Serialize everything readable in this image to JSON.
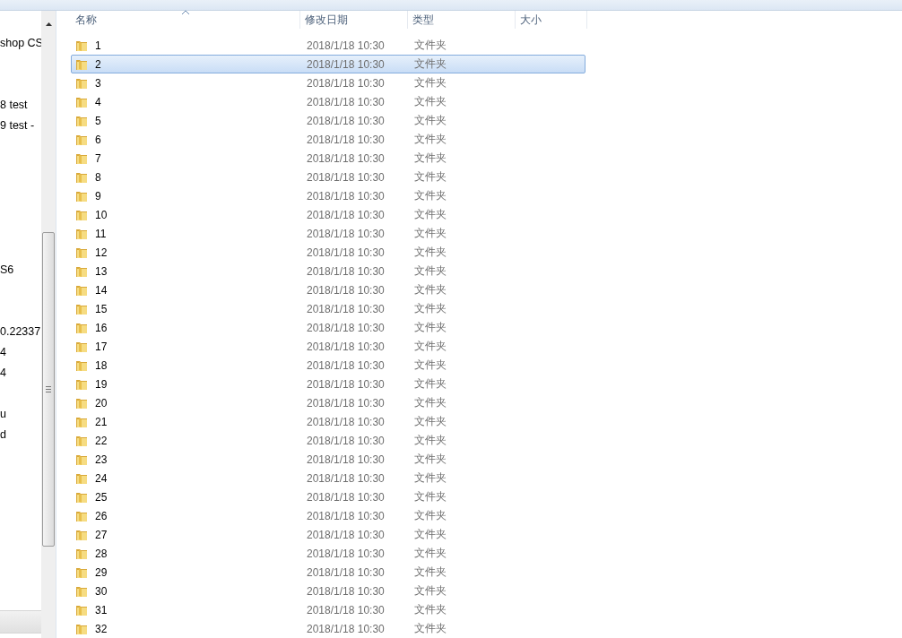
{
  "sidebar": {
    "items": [
      {
        "label": "shop CS"
      },
      {
        "label": "8 test"
      },
      {
        "label": "9 test -"
      },
      {
        "label": "S6"
      },
      {
        "label": "0.22337"
      },
      {
        "label": "4"
      },
      {
        "label": "4"
      },
      {
        "label": "u"
      },
      {
        "label": "d"
      }
    ]
  },
  "table": {
    "columns": [
      {
        "label": "名称",
        "sorted": true
      },
      {
        "label": "修改日期",
        "sorted": false
      },
      {
        "label": "类型",
        "sorted": false
      },
      {
        "label": "大小",
        "sorted": false
      }
    ],
    "rows": [
      {
        "name": "1",
        "modified": "2018/1/18 10:30",
        "type": "文件夹",
        "selected": false
      },
      {
        "name": "2",
        "modified": "2018/1/18 10:30",
        "type": "文件夹",
        "selected": true
      },
      {
        "name": "3",
        "modified": "2018/1/18 10:30",
        "type": "文件夹",
        "selected": false
      },
      {
        "name": "4",
        "modified": "2018/1/18 10:30",
        "type": "文件夹",
        "selected": false
      },
      {
        "name": "5",
        "modified": "2018/1/18 10:30",
        "type": "文件夹",
        "selected": false
      },
      {
        "name": "6",
        "modified": "2018/1/18 10:30",
        "type": "文件夹",
        "selected": false
      },
      {
        "name": "7",
        "modified": "2018/1/18 10:30",
        "type": "文件夹",
        "selected": false
      },
      {
        "name": "8",
        "modified": "2018/1/18 10:30",
        "type": "文件夹",
        "selected": false
      },
      {
        "name": "9",
        "modified": "2018/1/18 10:30",
        "type": "文件夹",
        "selected": false
      },
      {
        "name": "10",
        "modified": "2018/1/18 10:30",
        "type": "文件夹",
        "selected": false
      },
      {
        "name": "11",
        "modified": "2018/1/18 10:30",
        "type": "文件夹",
        "selected": false
      },
      {
        "name": "12",
        "modified": "2018/1/18 10:30",
        "type": "文件夹",
        "selected": false
      },
      {
        "name": "13",
        "modified": "2018/1/18 10:30",
        "type": "文件夹",
        "selected": false
      },
      {
        "name": "14",
        "modified": "2018/1/18 10:30",
        "type": "文件夹",
        "selected": false
      },
      {
        "name": "15",
        "modified": "2018/1/18 10:30",
        "type": "文件夹",
        "selected": false
      },
      {
        "name": "16",
        "modified": "2018/1/18 10:30",
        "type": "文件夹",
        "selected": false
      },
      {
        "name": "17",
        "modified": "2018/1/18 10:30",
        "type": "文件夹",
        "selected": false
      },
      {
        "name": "18",
        "modified": "2018/1/18 10:30",
        "type": "文件夹",
        "selected": false
      },
      {
        "name": "19",
        "modified": "2018/1/18 10:30",
        "type": "文件夹",
        "selected": false
      },
      {
        "name": "20",
        "modified": "2018/1/18 10:30",
        "type": "文件夹",
        "selected": false
      },
      {
        "name": "21",
        "modified": "2018/1/18 10:30",
        "type": "文件夹",
        "selected": false
      },
      {
        "name": "22",
        "modified": "2018/1/18 10:30",
        "type": "文件夹",
        "selected": false
      },
      {
        "name": "23",
        "modified": "2018/1/18 10:30",
        "type": "文件夹",
        "selected": false
      },
      {
        "name": "24",
        "modified": "2018/1/18 10:30",
        "type": "文件夹",
        "selected": false
      },
      {
        "name": "25",
        "modified": "2018/1/18 10:30",
        "type": "文件夹",
        "selected": false
      },
      {
        "name": "26",
        "modified": "2018/1/18 10:30",
        "type": "文件夹",
        "selected": false
      },
      {
        "name": "27",
        "modified": "2018/1/18 10:30",
        "type": "文件夹",
        "selected": false
      },
      {
        "name": "28",
        "modified": "2018/1/18 10:30",
        "type": "文件夹",
        "selected": false
      },
      {
        "name": "29",
        "modified": "2018/1/18 10:30",
        "type": "文件夹",
        "selected": false
      },
      {
        "name": "30",
        "modified": "2018/1/18 10:30",
        "type": "文件夹",
        "selected": false
      },
      {
        "name": "31",
        "modified": "2018/1/18 10:30",
        "type": "文件夹",
        "selected": false
      },
      {
        "name": "32",
        "modified": "2018/1/18 10:30",
        "type": "文件夹",
        "selected": false
      }
    ]
  }
}
